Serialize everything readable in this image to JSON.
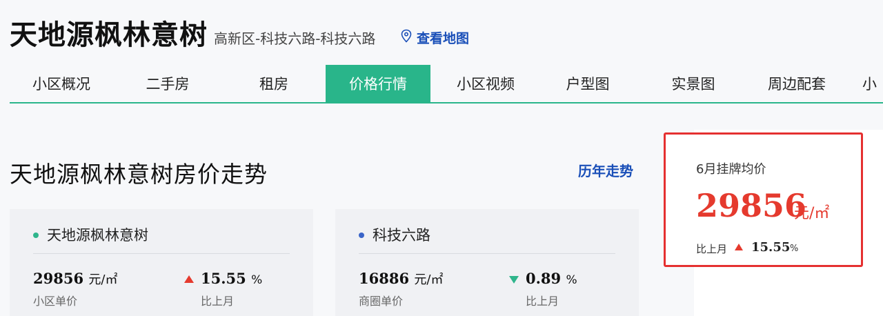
{
  "header": {
    "title": "天地源枫林意树",
    "address": "高新区-科技六路-科技六路",
    "map_link": "查看地图"
  },
  "tabs": [
    "小区概况",
    "二手房",
    "租房",
    "价格行情",
    "小区视频",
    "户型图",
    "实景图",
    "周边配套",
    "小"
  ],
  "active_tab": "价格行情",
  "trend": {
    "title": "天地源枫林意树房价走势",
    "history_link": "历年走势"
  },
  "cards": [
    {
      "name": "天地源枫林意树",
      "dot_color": "#2fb58c",
      "price": "29856",
      "unit": "元/㎡",
      "price_label": "小区单价",
      "direction": "up",
      "change": "15.55",
      "pct": "%",
      "change_label": "比上月"
    },
    {
      "name": "科技六路",
      "dot_color": "#3a64c8",
      "price": "16886",
      "unit": "元/㎡",
      "price_label": "商圈单价",
      "direction": "down",
      "change": "0.89",
      "pct": "%",
      "change_label": "比上月"
    }
  ],
  "highlight": {
    "label": "6月挂牌均价",
    "price": "29856",
    "unit": "元/㎡",
    "mom_label": "比上月",
    "direction": "up",
    "change": "15.55",
    "pct": "%"
  },
  "colors": {
    "accent": "#29b58a",
    "link": "#1a4fb8",
    "up": "#e53a2e",
    "down": "#2fb58c",
    "highlight_border": "#e53030"
  }
}
